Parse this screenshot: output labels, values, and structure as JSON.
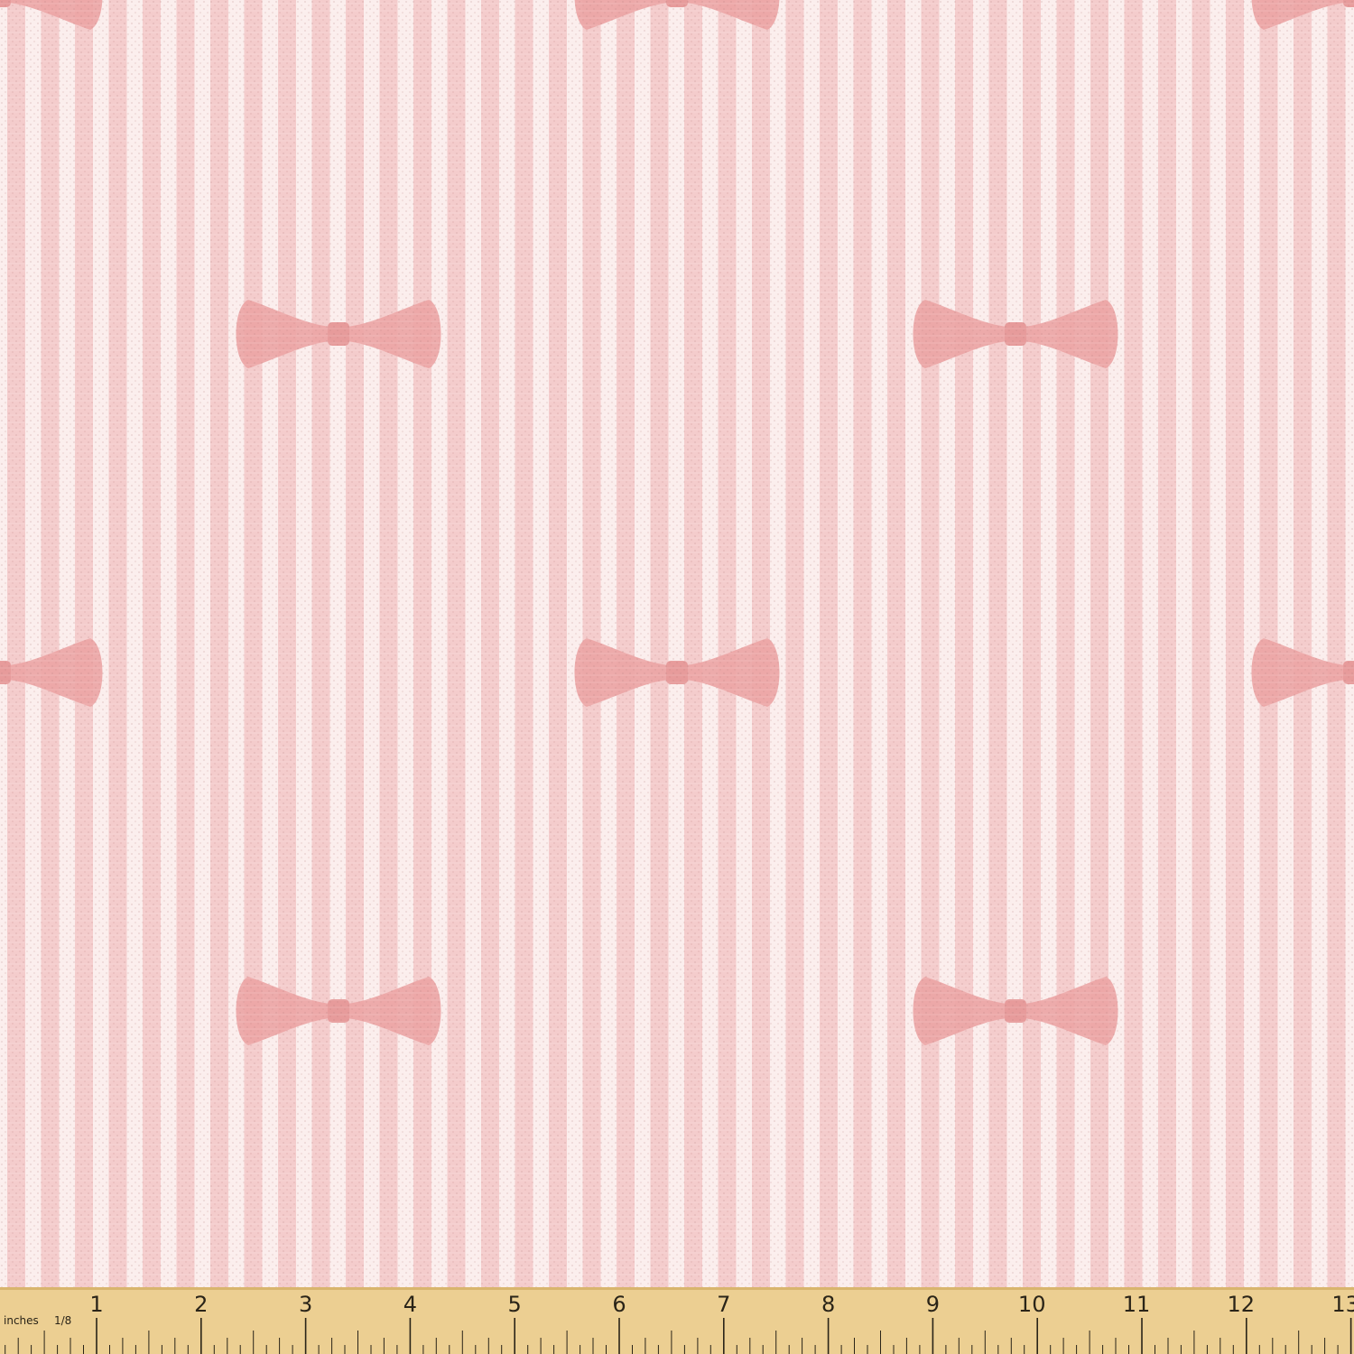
{
  "fabric": {
    "pattern": "vertical stripes with bow ties",
    "colors": {
      "background": "#fbeeed",
      "stripe": "#f2c6c6",
      "bow": "#eca5a5",
      "bow_knot": "#e79b9b",
      "weave": "#e3b0b0"
    }
  },
  "ruler": {
    "unit_label": "inches",
    "subdivision_label": "1/8",
    "numbers": [
      "1",
      "2",
      "3",
      "4",
      "5",
      "6",
      "7",
      "8",
      "9",
      "10",
      "11",
      "12",
      "13"
    ],
    "colors": {
      "wood": "#eccf92",
      "wood_dark": "#d9b56d",
      "ink": "#2a2418"
    }
  }
}
